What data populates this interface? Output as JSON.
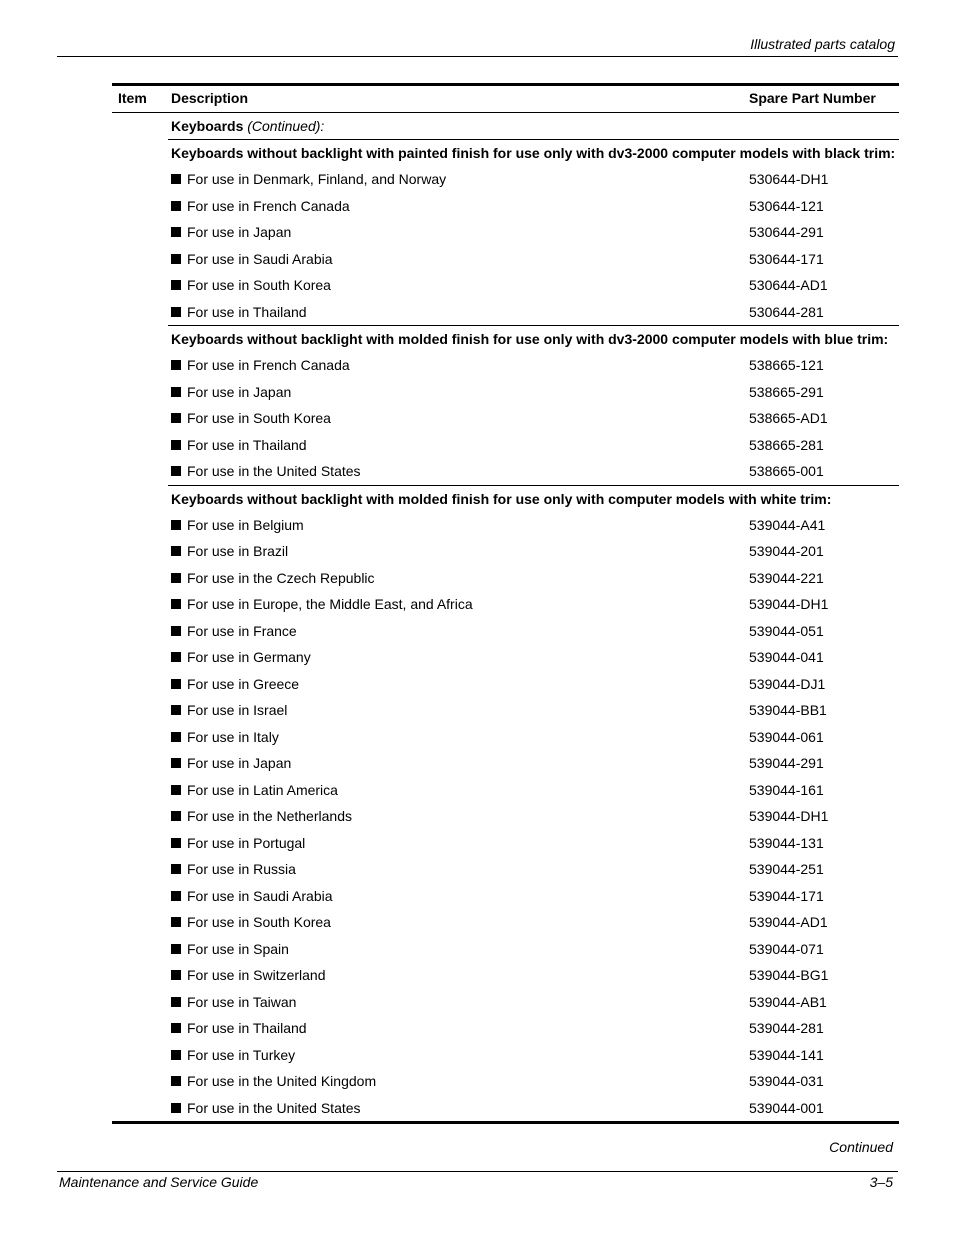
{
  "header": {
    "running_title": "Illustrated parts catalog"
  },
  "table": {
    "columns": {
      "item": "Item",
      "description": "Description",
      "part": "Spare Part Number"
    },
    "category": {
      "bold": "Keyboards",
      "italic": "(Continued):"
    },
    "sections": [
      {
        "title": "Keyboards without backlight with painted finish for use only with dv3-2000 computer models with black trim:",
        "rows": [
          {
            "desc": "For use in Denmark, Finland, and Norway",
            "part": "530644-DH1"
          },
          {
            "desc": "For use in French Canada",
            "part": "530644-121"
          },
          {
            "desc": "For use in Japan",
            "part": "530644-291"
          },
          {
            "desc": "For use in Saudi Arabia",
            "part": "530644-171"
          },
          {
            "desc": "For use in South Korea",
            "part": "530644-AD1"
          },
          {
            "desc": "For use in Thailand",
            "part": "530644-281"
          }
        ]
      },
      {
        "title": "Keyboards without backlight with molded finish for use only with dv3-2000 computer models with blue trim:",
        "rows": [
          {
            "desc": "For use in French Canada",
            "part": "538665-121"
          },
          {
            "desc": "For use in Japan",
            "part": "538665-291"
          },
          {
            "desc": "For use in South Korea",
            "part": "538665-AD1"
          },
          {
            "desc": "For use in Thailand",
            "part": "538665-281"
          },
          {
            "desc": "For use in the United States",
            "part": "538665-001"
          }
        ]
      },
      {
        "title": "Keyboards without backlight with molded finish for use only with computer models with white trim:",
        "rows": [
          {
            "desc": "For use in Belgium",
            "part": "539044-A41"
          },
          {
            "desc": "For use in Brazil",
            "part": "539044-201"
          },
          {
            "desc": "For use in the Czech Republic",
            "part": "539044-221"
          },
          {
            "desc": "For use in Europe, the Middle East, and Africa",
            "part": "539044-DH1"
          },
          {
            "desc": "For use in France",
            "part": "539044-051"
          },
          {
            "desc": "For use in Germany",
            "part": "539044-041"
          },
          {
            "desc": "For use in Greece",
            "part": "539044-DJ1"
          },
          {
            "desc": "For use in Israel",
            "part": "539044-BB1"
          },
          {
            "desc": "For use in Italy",
            "part": "539044-061"
          },
          {
            "desc": "For use in Japan",
            "part": "539044-291"
          },
          {
            "desc": "For use in Latin America",
            "part": "539044-161"
          },
          {
            "desc": "For use in the Netherlands",
            "part": "539044-DH1"
          },
          {
            "desc": "For use in Portugal",
            "part": "539044-131"
          },
          {
            "desc": "For use in Russia",
            "part": "539044-251"
          },
          {
            "desc": "For use in Saudi Arabia",
            "part": "539044-171"
          },
          {
            "desc": "For use in South Korea",
            "part": "539044-AD1"
          },
          {
            "desc": "For use in Spain",
            "part": "539044-071"
          },
          {
            "desc": "For use in Switzerland",
            "part": "539044-BG1"
          },
          {
            "desc": "For use in Taiwan",
            "part": "539044-AB1"
          },
          {
            "desc": "For use in Thailand",
            "part": "539044-281"
          },
          {
            "desc": "For use in Turkey",
            "part": "539044-141"
          },
          {
            "desc": "For use in the United Kingdom",
            "part": "539044-031"
          },
          {
            "desc": "For use in the United States",
            "part": "539044-001"
          }
        ]
      }
    ],
    "continued_label": "Continued"
  },
  "footer": {
    "left": "Maintenance and Service Guide",
    "right": "3–5"
  }
}
